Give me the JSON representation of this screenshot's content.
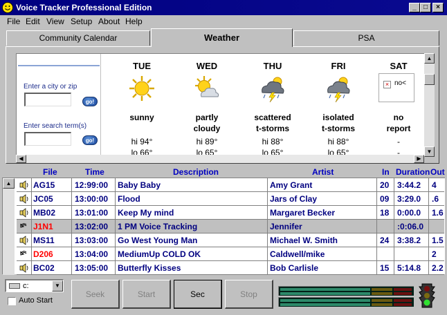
{
  "window": {
    "title": "Voice Tracker Professional Edition",
    "controls": {
      "minimize": "_",
      "maximize": "□",
      "close": "×"
    }
  },
  "menu": [
    "File",
    "Edit",
    "View",
    "Setup",
    "About",
    "Help"
  ],
  "tabs": [
    {
      "label": "Community Calendar",
      "active": false
    },
    {
      "label": "Weather",
      "active": true
    },
    {
      "label": "PSA",
      "active": false
    }
  ],
  "weather": {
    "city_label": "Enter a city or zip",
    "search_label": "Enter search term(s)",
    "go_label": "go!",
    "days": [
      {
        "name": "TUE",
        "cond1": "sunny",
        "cond2": "",
        "hi": "hi 94°",
        "lo": "lo 66°",
        "icon": "sun-icon"
      },
      {
        "name": "WED",
        "cond1": "partly",
        "cond2": "cloudy",
        "hi": "hi 89°",
        "lo": "lo 65°",
        "icon": "partly-cloudy-icon"
      },
      {
        "name": "THU",
        "cond1": "scattered",
        "cond2": "t-storms",
        "hi": "hi 88°",
        "lo": "lo 65°",
        "icon": "thunderstorm-icon"
      },
      {
        "name": "FRI",
        "cond1": "isolated",
        "cond2": "t-storms",
        "hi": "hi 88°",
        "lo": "lo 65°",
        "icon": "thunderstorm-icon"
      },
      {
        "name": "SAT",
        "cond1": "no",
        "cond2": "report",
        "hi": "-",
        "lo": "-",
        "icon": "broken-image-icon",
        "icon_text": "no<"
      }
    ]
  },
  "playlist": {
    "headers": {
      "file": "File",
      "time": "Time",
      "description": "Description",
      "artist": "Artist",
      "in": "In",
      "duration": "Duration",
      "out": "Out"
    },
    "rows": [
      {
        "type": "audio",
        "file": "AG15",
        "time": "12:99:00",
        "description": "Baby Baby",
        "artist": "Amy Grant",
        "in": "20",
        "duration": "3:44.2",
        "out": "4",
        "file_color": "#000080"
      },
      {
        "type": "audio",
        "file": "JC05",
        "time": "13:00:00",
        "description": "Flood",
        "artist": "Jars of Clay",
        "in": "09",
        "duration": "3:29.0",
        "out": ".6",
        "file_color": "#000080"
      },
      {
        "type": "audio",
        "file": "MB02",
        "time": "13:01:00",
        "description": "Keep My mind",
        "artist": "Margaret  Becker",
        "in": "18",
        "duration": "0:00.0",
        "out": "1.6",
        "file_color": "#000080"
      },
      {
        "type": "voice",
        "file": "J1N1",
        "time": "13:02:00",
        "description": "1 PM Voice Tracking",
        "artist": "Jennifer",
        "in": "",
        "duration": ":0:06.0",
        "out": "",
        "file_color": "#ff0000",
        "highlight": true
      },
      {
        "type": "audio",
        "file": "MS11",
        "time": "13:03:00",
        "description": "Go West Young Man",
        "artist": "Michael W. Smith",
        "in": "24",
        "duration": "3:38.2",
        "out": "1.5",
        "file_color": "#000080"
      },
      {
        "type": "voice",
        "file": "D206",
        "time": "13:04:00",
        "description": "MediumUp  COLD OK",
        "artist": "Caldwell/mike",
        "in": "",
        "duration": "",
        "out": "2",
        "file_color": "#ff0000"
      },
      {
        "type": "audio",
        "file": "BC02",
        "time": "13:05:00",
        "description": "Butterfly Kisses",
        "artist": "Bob Carlisle",
        "in": "15",
        "duration": "5:14.8",
        "out": "2.2",
        "file_color": "#000080"
      }
    ]
  },
  "controls": {
    "drive": "c:",
    "auto_start": "Auto Start",
    "buttons": [
      {
        "label": "Seek",
        "enabled": false
      },
      {
        "label": "Start",
        "enabled": false
      },
      {
        "label": "Sec",
        "enabled": true
      },
      {
        "label": "Stop",
        "enabled": false
      }
    ]
  },
  "colors": {
    "titlebar": "#000080",
    "header_text": "#0000c0",
    "voice_file": "#ff0000",
    "audio_file": "#000080"
  }
}
